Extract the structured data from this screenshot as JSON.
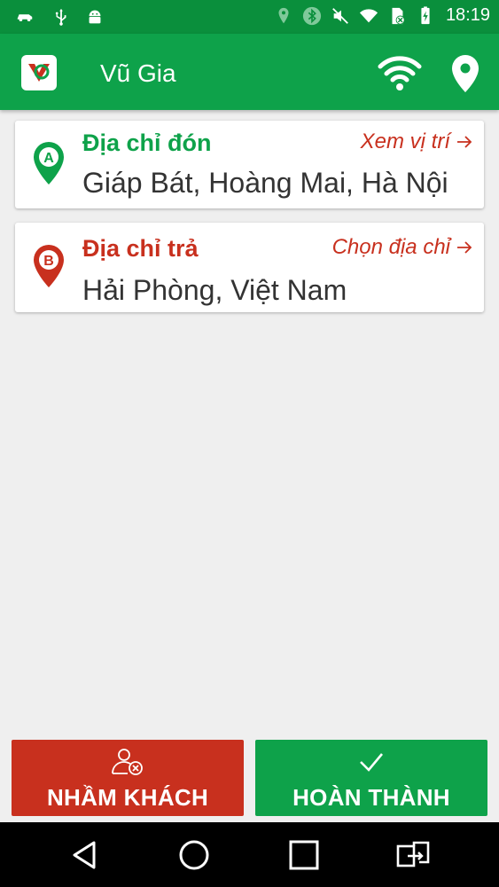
{
  "status_bar": {
    "time": "18:19",
    "left_icons": [
      "car-icon",
      "usb-icon",
      "android-icon"
    ],
    "right_icons": [
      "location-icon",
      "bluetooth-icon",
      "mute-icon",
      "wifi-icon",
      "sim-icon",
      "battery-icon"
    ]
  },
  "app_bar": {
    "title": "Vũ Gia",
    "icons": [
      "app-logo-icon",
      "wifi-icon",
      "location-pin-icon"
    ]
  },
  "pickup": {
    "label": "Địa chỉ đón",
    "action": "Xem vị trí",
    "value": "Giáp Bát, Hoàng Mai, Hà Nội",
    "marker": "A"
  },
  "dropoff": {
    "label": "Địa chỉ trả",
    "action": "Chọn địa chỉ",
    "value": "Hải Phòng, Việt Nam",
    "marker": "B"
  },
  "buttons": {
    "wrong_customer": "NHẦM KHÁCH",
    "complete": "HOÀN THÀNH"
  },
  "colors": {
    "primary_green": "#0ea24a",
    "status_green": "#0a8f3c",
    "accent_red": "#c8301e"
  },
  "nav_bar": {
    "icons": [
      "back-icon",
      "home-icon",
      "recents-icon",
      "switch-app-icon"
    ]
  }
}
